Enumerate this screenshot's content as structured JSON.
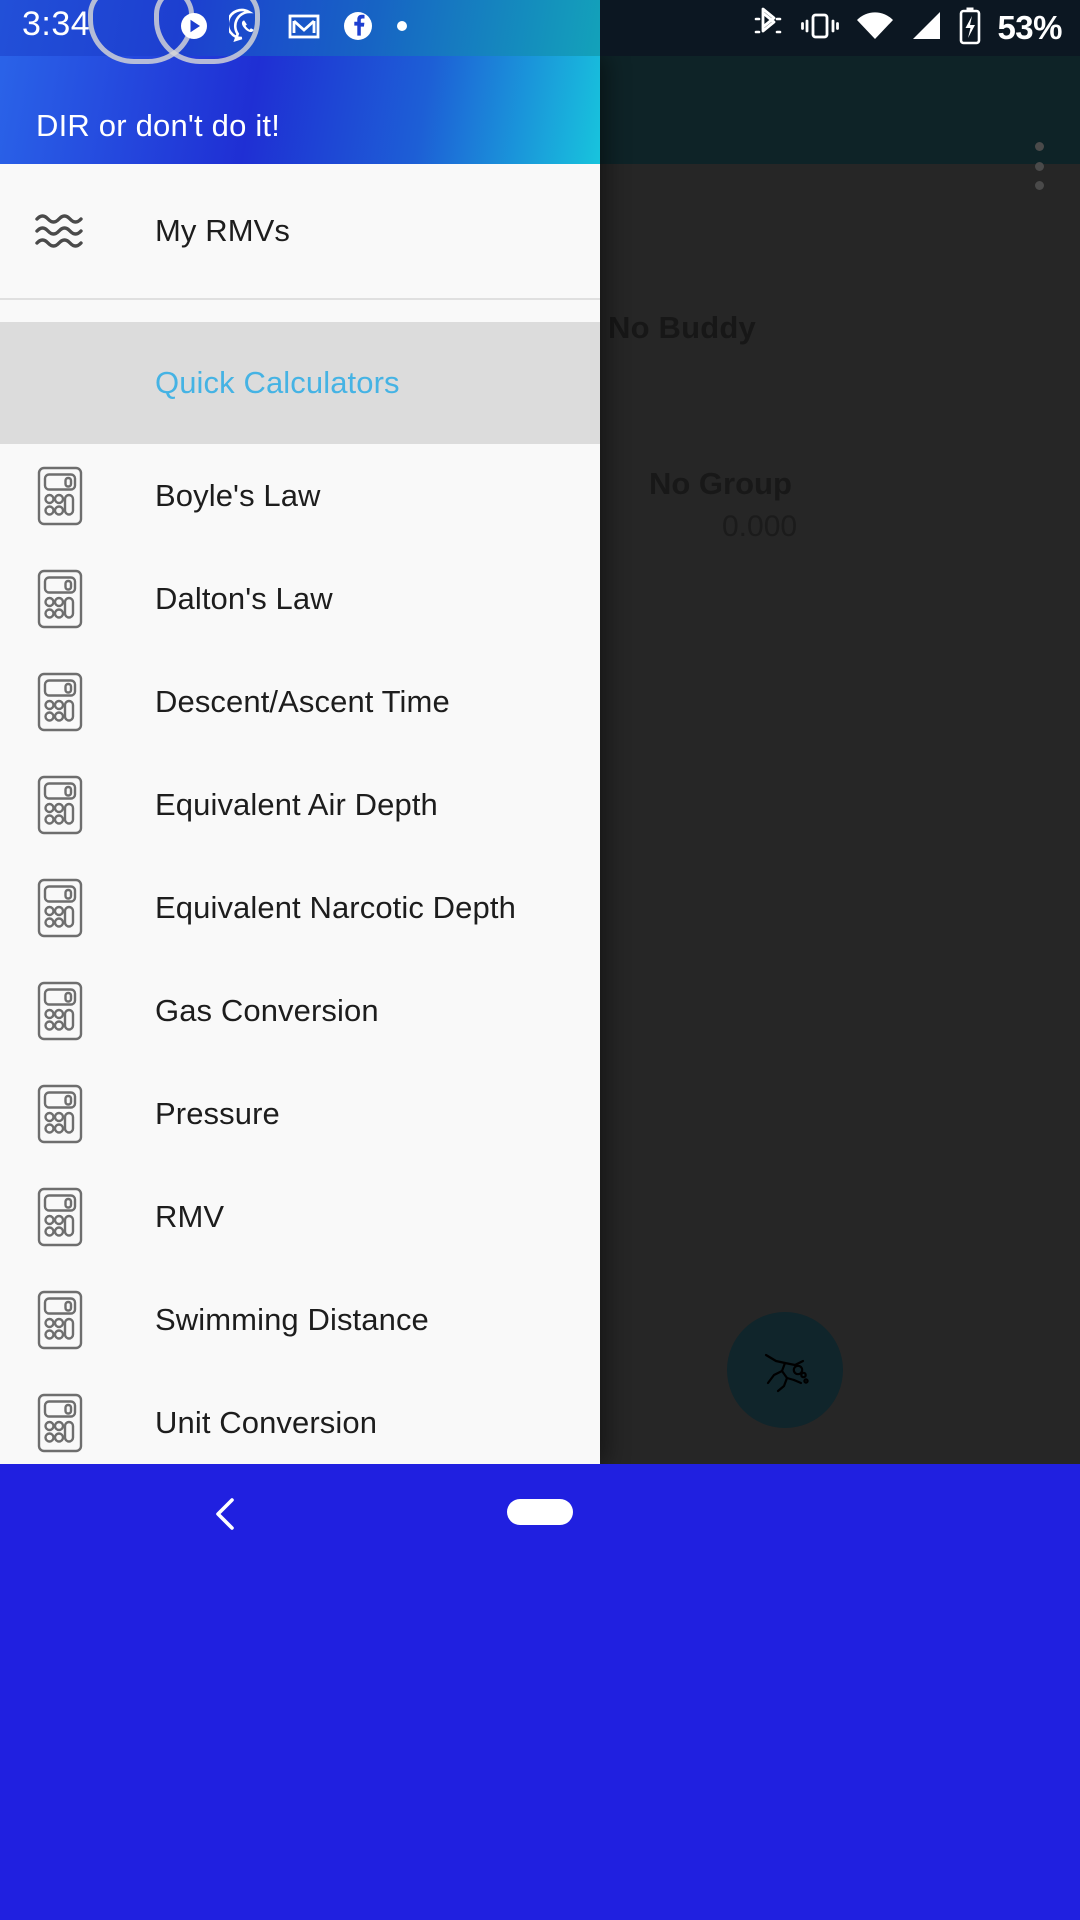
{
  "status_bar": {
    "clock": "3:34",
    "battery_text": "53%",
    "left_icons": [
      {
        "name": "play-store-icon"
      },
      {
        "name": "whatsapp-icon"
      },
      {
        "name": "gmail-icon"
      },
      {
        "name": "facebook-icon"
      },
      {
        "name": "more-notifications-dot-icon"
      }
    ],
    "right_icons": [
      {
        "name": "bluetooth-icon"
      },
      {
        "name": "vibrate-icon"
      },
      {
        "name": "wifi-icon"
      },
      {
        "name": "cellular-signal-icon"
      },
      {
        "name": "battery-charging-icon"
      }
    ],
    "colors": {
      "left_gradient_start": "#2250d8",
      "left_gradient_end": "#13a2ba",
      "right_background": "#0c1722"
    }
  },
  "drawer": {
    "header": {
      "title": "DIR or don't do it!",
      "gradient_start": "#2a63e8",
      "gradient_end": "#18c4dd"
    },
    "primary_items": [
      {
        "label": "My RMVs",
        "icon": "waves-icon"
      }
    ],
    "section": {
      "label": "Quick Calculators",
      "label_color": "#45b3e4",
      "background_color": "#dcdcdc"
    },
    "calculator_items": [
      {
        "label": "Boyle's Law",
        "icon": "calculator-icon"
      },
      {
        "label": "Dalton's Law",
        "icon": "calculator-icon"
      },
      {
        "label": "Descent/Ascent Time",
        "icon": "calculator-icon"
      },
      {
        "label": "Equivalent Air Depth",
        "icon": "calculator-icon"
      },
      {
        "label": "Equivalent Narcotic Depth",
        "icon": "calculator-icon"
      },
      {
        "label": "Gas Conversion",
        "icon": "calculator-icon"
      },
      {
        "label": "Pressure",
        "icon": "calculator-icon"
      },
      {
        "label": "RMV",
        "icon": "calculator-icon"
      },
      {
        "label": "Swimming Distance",
        "icon": "calculator-icon"
      },
      {
        "label": "Unit Conversion",
        "icon": "calculator-icon"
      }
    ]
  },
  "background_app": {
    "buddy_label": "No Buddy",
    "group_label": "No Group",
    "value": "0.000",
    "overflow_menu": "overflow-menu-icon",
    "fab": "scuba-diver-icon",
    "fab_color": "#10252b",
    "scrim_color": "#262626"
  },
  "navigation_bar": {
    "background_color": "#2020e0",
    "back_button": "back-chevron-icon",
    "home_pill": "home-pill-icon"
  }
}
